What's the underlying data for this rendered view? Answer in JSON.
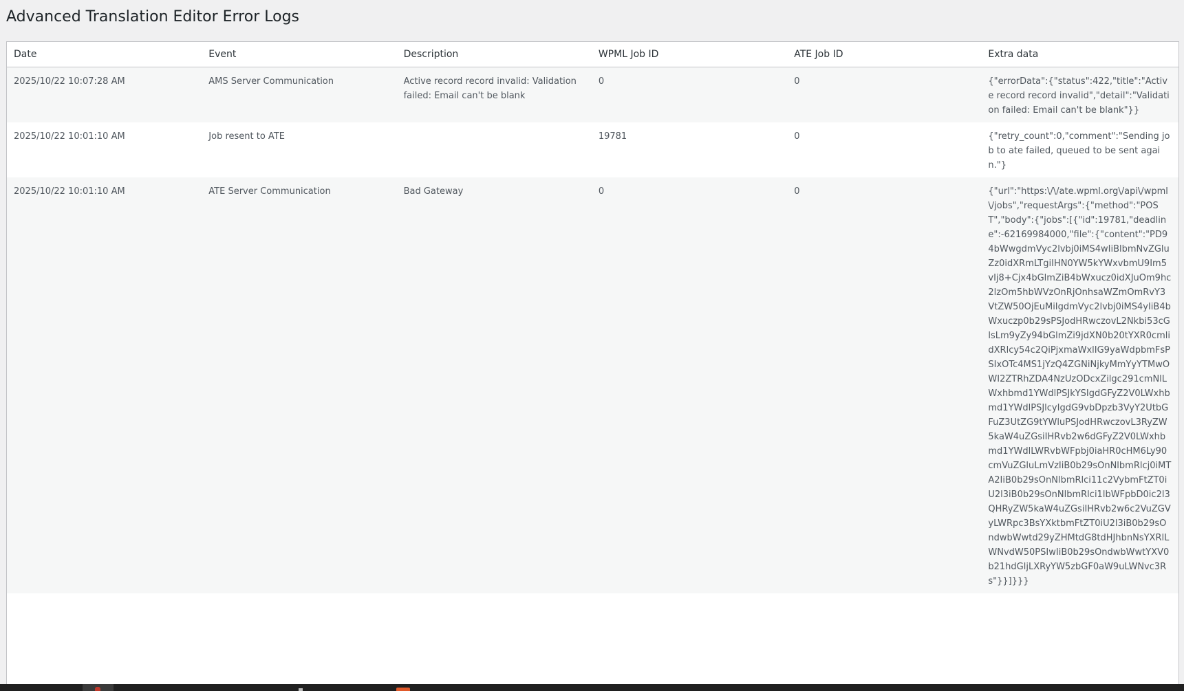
{
  "page": {
    "title": "Advanced Translation Editor Error Logs"
  },
  "table": {
    "columns": [
      "Date",
      "Event",
      "Description",
      "WPML Job ID",
      "ATE Job ID",
      "Extra data"
    ],
    "rows": [
      {
        "date": "2025/10/22 10:07:28 AM",
        "event": "AMS Server Communication",
        "description": "Active record record invalid: Validation failed: Email can't be blank",
        "wpml_job_id": "0",
        "ate_job_id": "0",
        "extra_data": "{\"errorData\":{\"status\":422,\"title\":\"Active record record invalid\",\"detail\":\"Validation failed: Email can't be blank\"}}"
      },
      {
        "date": "2025/10/22 10:01:10 AM",
        "event": "Job resent to ATE",
        "description": "",
        "wpml_job_id": "19781",
        "ate_job_id": "0",
        "extra_data": "{\"retry_count\":0,\"comment\":\"Sending job to ate failed, queued to be sent again.\"}"
      },
      {
        "date": "2025/10/22 10:01:10 AM",
        "event": "ATE Server Communication",
        "description": "Bad Gateway",
        "wpml_job_id": "0",
        "ate_job_id": "0",
        "extra_data": "{\"url\":\"https:\\/\\/ate.wpml.org\\/api\\/wpml\\/jobs\",\"requestArgs\":{\"method\":\"POST\",\"body\":{\"jobs\":[{\"id\":19781,\"deadline\":-62169984000,\"file\":{\"content\":\"PD94bWwgdmVyc2lvbj0iMS4wIiBlbmNvZGluZz0idXRmLTgiIHN0YW5kYWxvbmU9Im5vIj8+Cjx4bGlmZiB4bWxucz0idXJuOm9hc2lzOm5hbWVzOnRjOnhsaWZmOmRvY3VtZW50OjEuMiIgdmVyc2lvbj0iMS4yIiB4bWxuczp0b29sPSJodHRwczovL2Nkbi53cGlsLm9yZy94bGlmZi9jdXN0b20tYXR0cmlidXRlcy54c2QiPjxmaWxlIG9yaWdpbmFsPSIxOTc4MS1jYzQ4ZGNiNjkyMmYyYTMwOWI2ZTRhZDA4NzUzODcxZilgc291cmNlLWxhbmd1YWdlPSJkYSIgdGFyZ2V0LWxhbmd1YWdlPSJlcyIgdG9vbDpzb3VyY2UtbGFuZ3UtZG9tYWluPSJodHRwczovL3RyZW5kaW4uZGsiIHRvb2w6dGFyZ2V0LWxhbmd1YWdlLWRvbWFpbj0iaHR0cHM6Ly90cmVuZGluLmVzIiB0b29sOnNlbmRlcj0iMTA2IiB0b29sOnNlbmRlci11c2VybmFtZT0iU2l3iB0b29sOnNlbmRlci1lbWFpbD0ic2l3QHRyZW5kaW4uZGsiIHRvb2w6c2VuZGVyLWRpc3BsYXktbmFtZT0iU2l3iB0b29sOndwbWwtd29yZHMtdG8tdHJhbnNsYXRlLWNvdW50PSIwIiB0b29sOndwbWwtYXV0b21hdGljLXRyYW5zbGF0aW9uLWNvc3Rs\"}}]}}}"
      }
    ]
  }
}
